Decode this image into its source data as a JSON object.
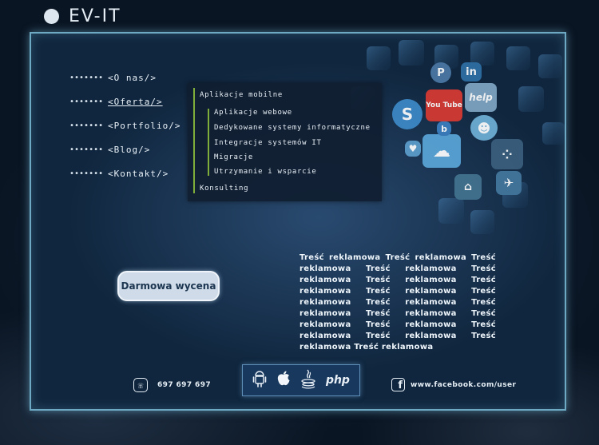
{
  "brand": {
    "name": "EV-IT"
  },
  "nav": {
    "items": [
      {
        "dots": "•••••••",
        "label": "<O nas/>"
      },
      {
        "dots": "•••••••",
        "label": "<Oferta/>"
      },
      {
        "dots": "•••••••",
        "label": "<Portfolio/>"
      },
      {
        "dots": "•••••••",
        "label": "<Blog/>"
      },
      {
        "dots": "•••••••",
        "label": "<Kontakt/>"
      }
    ]
  },
  "dropdown": {
    "items": [
      "Aplikacje mobilne",
      "Aplikacje webowe",
      "Dedykowane systemy informatyczne",
      "Integracje systemów IT",
      "Migracje",
      "Utrzymanie i wsparcie",
      "Konsulting"
    ]
  },
  "cta": {
    "label": "Darmowa wycena"
  },
  "ad": {
    "text": "Treść reklamowa Treść reklamowa Treść reklamowa Treść reklamowa Treść reklamowa Treść reklamowa Treść reklamowa Treść reklamowa Treść reklamowa Treść reklamowa Treść reklamowa Treść reklamowa Treść reklamowa Treść reklamowa Treść reklamowa Treść reklamowa Treść reklamowa Treść reklamowa"
  },
  "footer": {
    "phone": "697 697 697",
    "phone_icon": "phone-icon",
    "technologies": [
      {
        "icon": "android-icon"
      },
      {
        "icon": "apple-icon"
      },
      {
        "icon": "java-icon"
      },
      {
        "icon": "php-icon",
        "label": "php"
      }
    ],
    "facebook_url": "www.facebook.com/user",
    "facebook_icon": "facebook-icon"
  },
  "mosaic": {
    "tiles": [
      {
        "icon": "youtube-icon",
        "label": "You Tube",
        "color": "#d93a32"
      },
      {
        "icon": "help-icon",
        "label": "help",
        "color": "#7fa6c4"
      },
      {
        "icon": "linkedin-icon",
        "label": "in",
        "color": "#2f6fa5"
      },
      {
        "icon": "pinterest-icon",
        "label": "P",
        "color": "#4b79a6"
      },
      {
        "icon": "skype-icon",
        "label": "S",
        "color": "#3d8ac8"
      },
      {
        "icon": "cloud-icon",
        "color": "#5aa6d8"
      },
      {
        "icon": "reddit-icon",
        "color": "#6fb0d6"
      },
      {
        "icon": "android-icon",
        "color": "#43738f"
      },
      {
        "icon": "dots-icon",
        "color": "#3a5f7d"
      },
      {
        "icon": "heart-icon",
        "color": "#5d9fcc"
      },
      {
        "icon": "plane-icon",
        "color": "#44789f"
      },
      {
        "icon": "bluetooth-icon",
        "label": "b",
        "color": "#3b7fc0"
      }
    ]
  },
  "colors": {
    "accent_bar": "#7fae3a",
    "panel_border": "#6ea9c4",
    "cta_bg": "#cfdbe8",
    "background": "#0b1625"
  }
}
